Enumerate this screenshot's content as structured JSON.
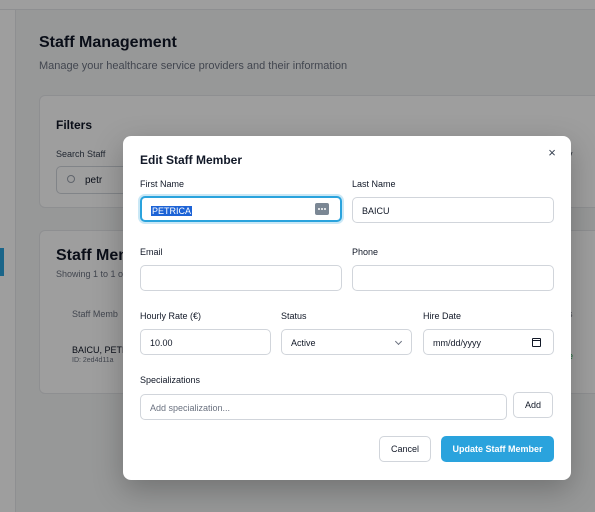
{
  "background": {
    "title": "Staff Management",
    "subtitle": "Manage your healthcare service providers and their information",
    "filters": {
      "title": "Filters",
      "search_label": "Search Staff",
      "search_value": "petr",
      "right_label": "y"
    },
    "staff": {
      "title": "Staff Mem",
      "count": "Showing 1 to 1 o",
      "col_header": "Staff Memb",
      "col_header_right": "s",
      "row_name": "BAICU, PETR",
      "row_id": "ID: 2ed4d11a",
      "row_right": "e"
    }
  },
  "modal": {
    "title": "Edit Staff Member",
    "close_glyph": "×",
    "first_name": {
      "label": "First Name",
      "value": "PETRICA"
    },
    "last_name": {
      "label": "Last Name",
      "value": "BAICU"
    },
    "email": {
      "label": "Email",
      "value": ""
    },
    "phone": {
      "label": "Phone",
      "value": ""
    },
    "hourly_rate": {
      "label": "Hourly Rate (€)",
      "value": "10.00"
    },
    "status": {
      "label": "Status",
      "value": "Active"
    },
    "hire_date": {
      "label": "Hire Date",
      "placeholder": "mm/dd/yyyy"
    },
    "specializations": {
      "label": "Specializations",
      "placeholder": "Add specialization..."
    },
    "add_label": "Add",
    "cancel_label": "Cancel",
    "update_label": "Update Staff Member"
  },
  "colors": {
    "accent": "#2aa3dd",
    "selection": "#1d63d6"
  },
  "icons": [
    "search-icon",
    "close-icon",
    "password-manager-icon",
    "chevron-down-icon",
    "calendar-icon"
  ]
}
